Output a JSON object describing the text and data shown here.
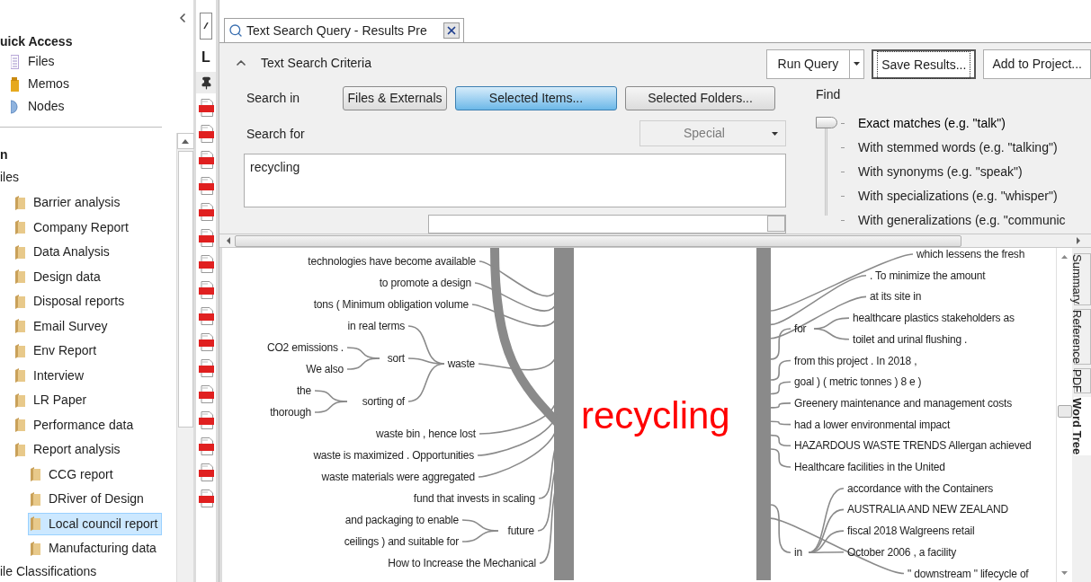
{
  "nav": {
    "quick_access": {
      "title": "uick Access",
      "items": [
        {
          "label": "Files",
          "kind": "files"
        },
        {
          "label": "Memos",
          "kind": "memos"
        },
        {
          "label": "Nodes",
          "kind": "nodes"
        }
      ]
    },
    "section_title": "n",
    "files_header": "iles",
    "folders": [
      {
        "name": "Barrier analysis",
        "selected": false
      },
      {
        "name": "Company Report",
        "selected": false
      },
      {
        "name": "Data Analysis",
        "selected": false
      },
      {
        "name": "Design data",
        "selected": false
      },
      {
        "name": "Disposal reports",
        "selected": false
      },
      {
        "name": "Email Survey",
        "selected": false
      },
      {
        "name": "Env Report",
        "selected": false
      },
      {
        "name": "Interview",
        "selected": false
      },
      {
        "name": "LR Paper",
        "selected": false
      },
      {
        "name": "Performance data",
        "selected": false
      },
      {
        "name": "Report analysis",
        "selected": false,
        "children": [
          {
            "name": "CCG report",
            "selected": false
          },
          {
            "name": "DRiver of Design",
            "selected": false
          },
          {
            "name": "Local council report",
            "selected": true
          },
          {
            "name": "Manufacturing data",
            "selected": false
          }
        ]
      }
    ],
    "footer": "ile Classifications"
  },
  "strip": {
    "letter": "L",
    "documents": [
      {
        "kind": "pdf"
      },
      {
        "kind": "pdf"
      },
      {
        "kind": "pdf"
      },
      {
        "kind": "pdf"
      },
      {
        "kind": "pdf"
      },
      {
        "kind": "pdf"
      },
      {
        "kind": "pdf"
      },
      {
        "kind": "pdf"
      },
      {
        "kind": "pdf"
      },
      {
        "kind": "pdf"
      },
      {
        "kind": "pdf"
      },
      {
        "kind": "pdf"
      },
      {
        "kind": "pdf"
      },
      {
        "kind": "pdf"
      },
      {
        "kind": "pdf"
      },
      {
        "kind": "pdf"
      }
    ]
  },
  "tab": {
    "title": "Text Search Query - Results Pre",
    "selected": true
  },
  "criteria": {
    "title": "Text Search Criteria",
    "expanded": true,
    "toolbar": [
      {
        "label": "Run Query",
        "kind": "split",
        "focused": false
      },
      {
        "label": "Save Results...",
        "kind": "plain",
        "focused": true
      },
      {
        "label": "Add to Project...",
        "kind": "plain",
        "focused": false
      }
    ],
    "search_in": {
      "label": "Search in",
      "options": [
        {
          "label": "Files & Externals",
          "selected": false
        },
        {
          "label": "Selected Items...",
          "selected": true
        },
        {
          "label": "Selected Folders...",
          "selected": false
        }
      ]
    },
    "search_for": {
      "label": "Search for",
      "value": "recycling"
    },
    "special": {
      "label": "Special",
      "disabled": true
    },
    "find": {
      "label": "Find",
      "options": [
        {
          "label": "Exact matches (e.g. \"talk\")",
          "selected": true
        },
        {
          "label": "With stemmed words (e.g. \"talking\")",
          "selected": false
        },
        {
          "label": "With synonyms (e.g. \"speak\")",
          "selected": false
        },
        {
          "label": "With specializations (e.g. \"whisper\")",
          "selected": false
        },
        {
          "label": "With generalizations (e.g. \"communic",
          "selected": false
        }
      ]
    }
  },
  "result_tabs": [
    {
      "label": "Summary",
      "selected": false
    },
    {
      "label": "Reference",
      "selected": false
    },
    {
      "label": "PDF",
      "selected": false
    },
    {
      "label": "Word Tree",
      "selected": true
    }
  ],
  "word_tree": {
    "keyword": "recycling",
    "left": [
      {
        "text": "technologies have become available"
      },
      {
        "text": "to promote a design"
      },
      {
        "text": "tons ( Minimum obligation volume"
      },
      {
        "text": "waste",
        "children": [
          {
            "text": "in real terms"
          },
          {
            "text": "sort",
            "children": [
              {
                "text": "CO2 emissions ."
              },
              {
                "text": "We also"
              }
            ]
          },
          {
            "text": "sorting of",
            "children": [
              {
                "text": "the"
              },
              {
                "text": "thorough"
              }
            ]
          }
        ]
      },
      {
        "text": "waste bin , hence lost"
      },
      {
        "text": "waste is maximized . Opportunities"
      },
      {
        "text": "waste materials were aggregated"
      },
      {
        "text": "fund that invests in scaling"
      },
      {
        "text": "future",
        "children": [
          {
            "text": "and packaging to enable"
          },
          {
            "text": "ceilings ) and suitable for"
          }
        ]
      },
      {
        "text": "How to Increase the Mechanical"
      }
    ],
    "right": [
      {
        "text": "which lessens the fresh"
      },
      {
        "text": ". To minimize the amount"
      },
      {
        "text": "at its site in"
      },
      {
        "text": "for",
        "children": [
          {
            "text": "healthcare plastics stakeholders as"
          },
          {
            "text": "toilet and urinal flushing ."
          }
        ]
      },
      {
        "text": "from this project . In 2018 ,"
      },
      {
        "text": "goal ) ( metric tonnes ) 8 e )"
      },
      {
        "text": "Greenery maintenance and management costs"
      },
      {
        "text": "had a lower environmental impact"
      },
      {
        "text": "HAZARDOUS WASTE TRENDS Allergan achieved"
      },
      {
        "text": "Healthcare facilities in the United"
      },
      {
        "text": "in",
        "children": [
          {
            "text": "accordance with the Containers"
          },
          {
            "text": "AUSTRALIA AND NEW ZEALAND"
          },
          {
            "text": "fiscal 2018 Walgreens retail"
          },
          {
            "text": "October 2006 , a facility"
          }
        ]
      },
      {
        "text": "\" downstream \" lifecycle of"
      }
    ]
  }
}
